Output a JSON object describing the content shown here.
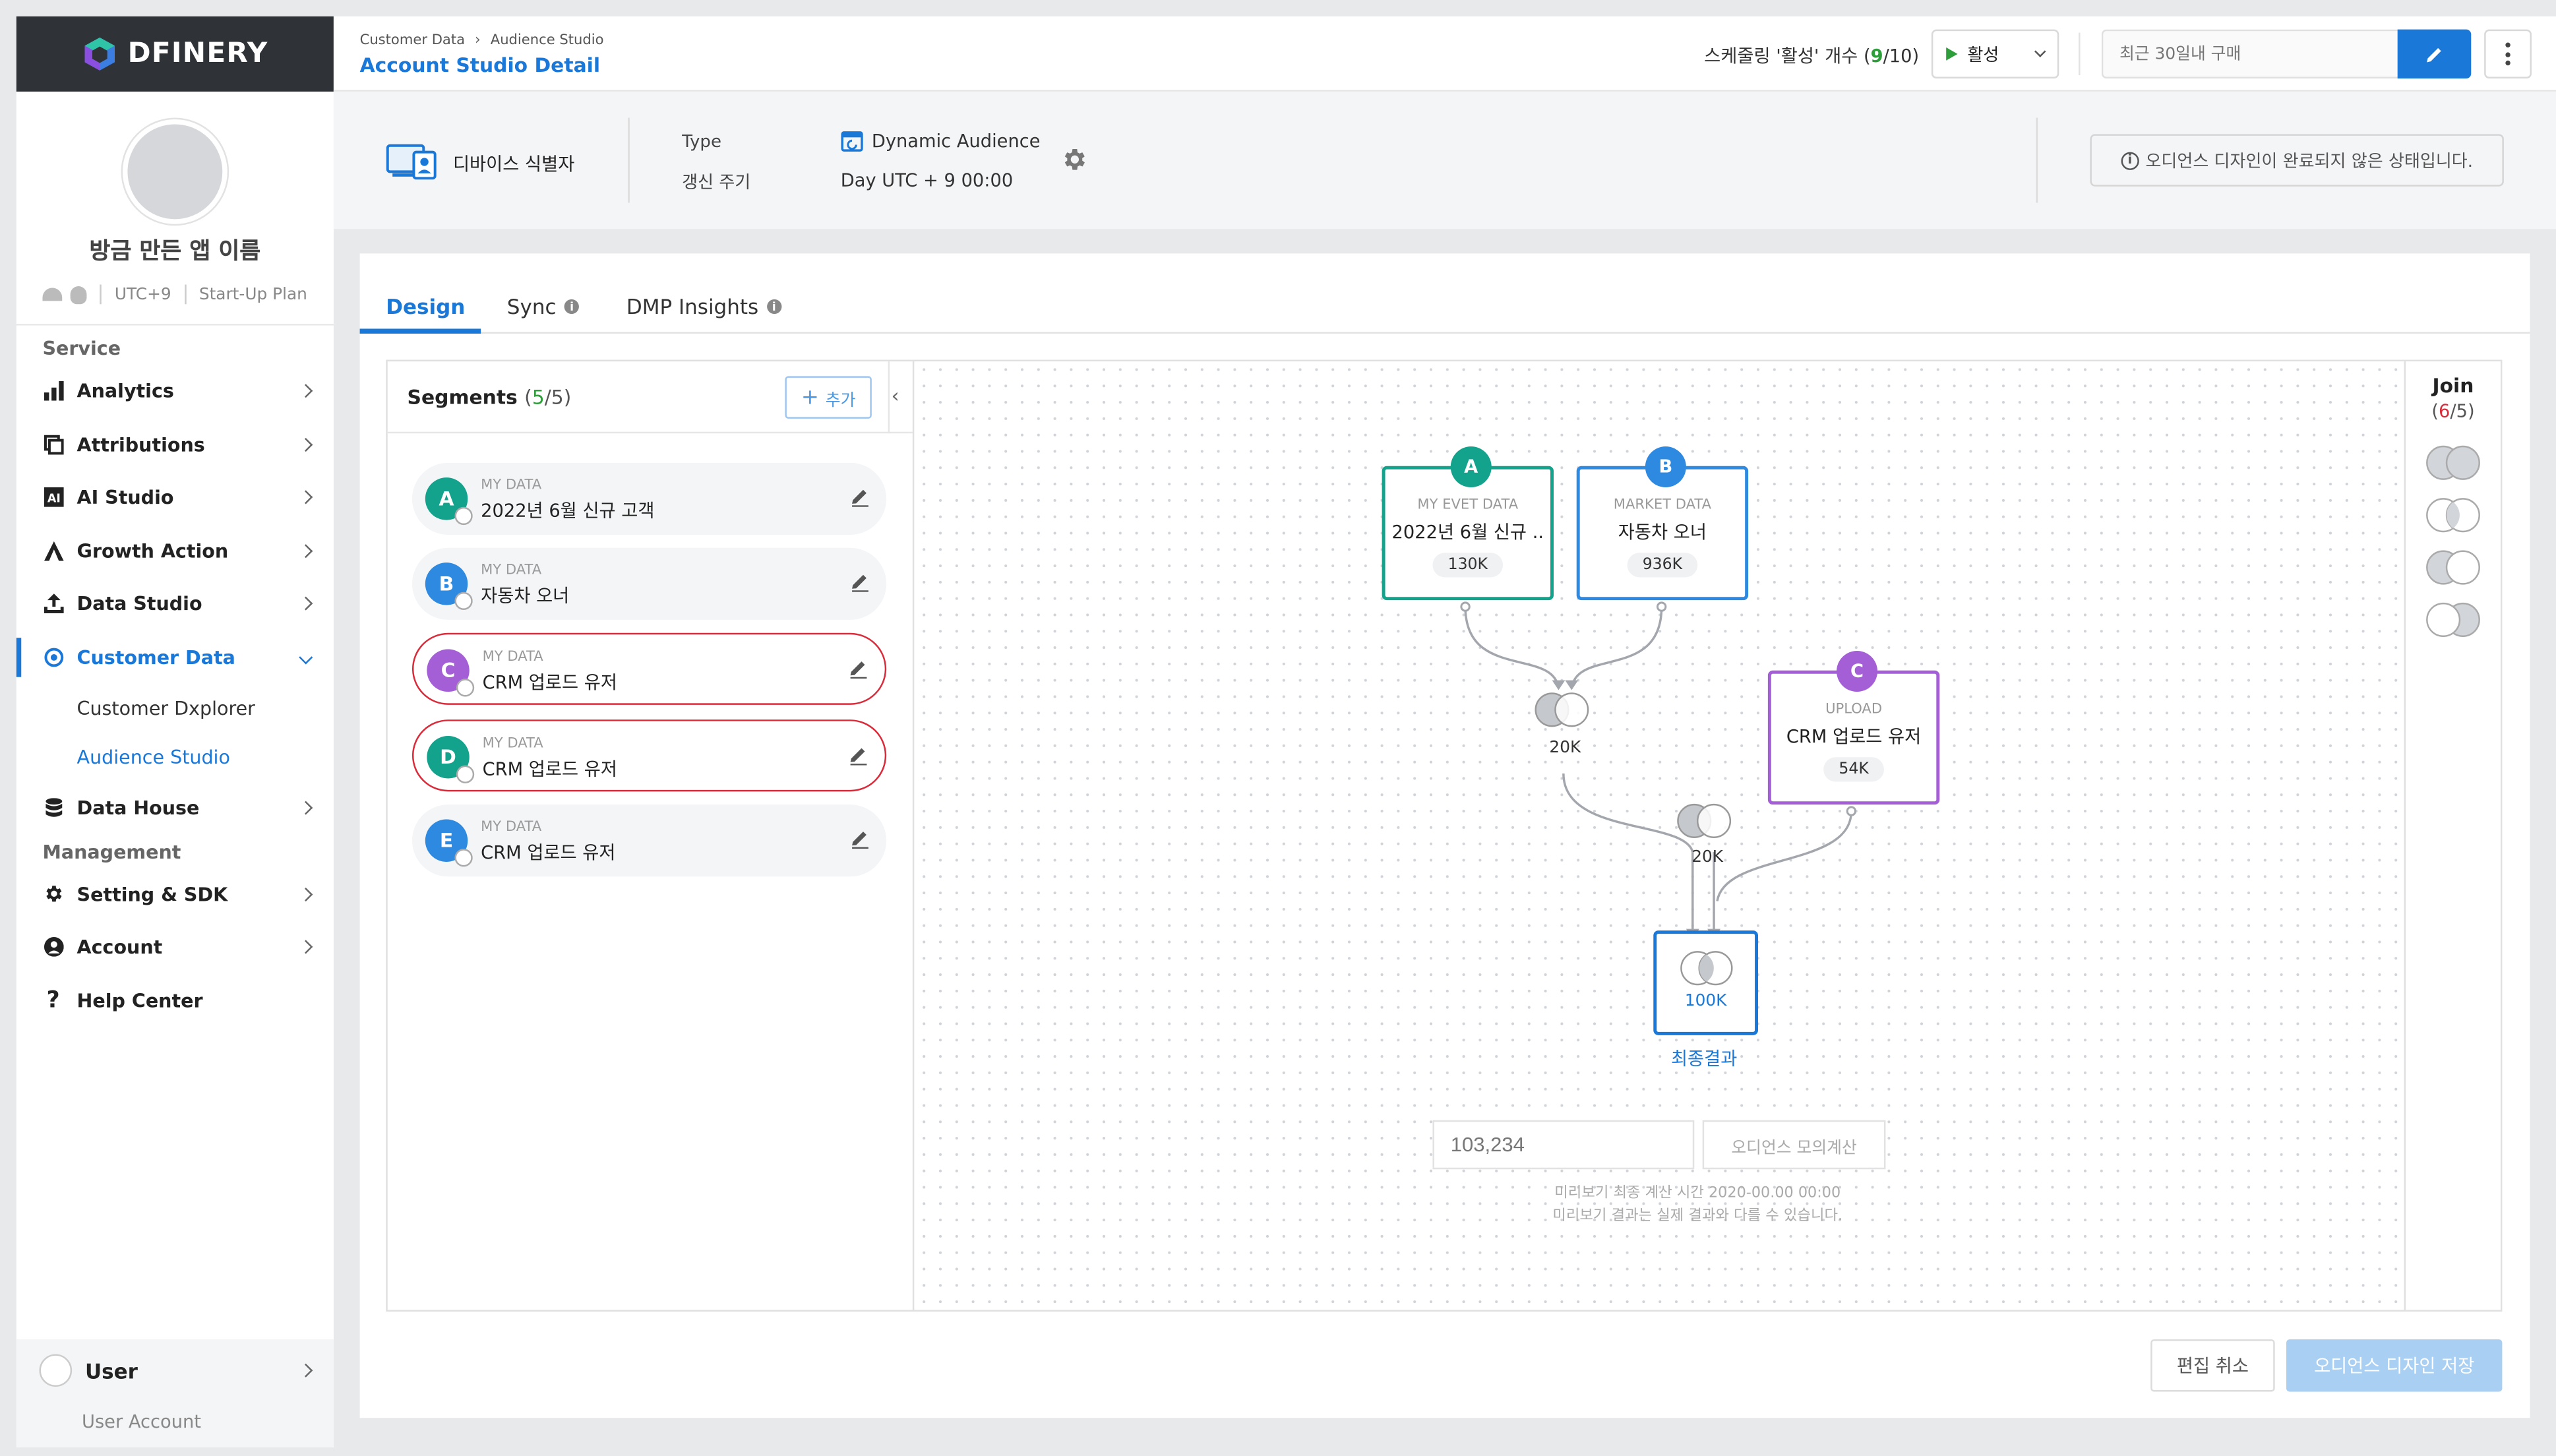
{
  "brand": {
    "name": "DFINERY"
  },
  "profile": {
    "app_name": "방금 만든 앱 이름",
    "timezone": "UTC+9",
    "plan": "Start-Up Plan"
  },
  "sidebar": {
    "service_title": "Service",
    "management_title": "Management",
    "service_items": [
      {
        "label": "Analytics",
        "icon": "bar-chart-icon"
      },
      {
        "label": "Attributions",
        "icon": "attribution-icon"
      },
      {
        "label": "AI Studio",
        "icon": "ai-icon"
      },
      {
        "label": "Growth Action",
        "icon": "growth-icon"
      },
      {
        "label": "Data Studio",
        "icon": "upload-icon"
      },
      {
        "label": "Customer Data",
        "icon": "target-icon"
      }
    ],
    "customer_data_sub": [
      "Customer Dxplorer",
      "Audience Studio"
    ],
    "data_house": {
      "label": "Data House",
      "icon": "database-icon"
    },
    "management_items": [
      {
        "label": "Setting & SDK",
        "icon": "gear-icon"
      },
      {
        "label": "Account",
        "icon": "person-icon"
      },
      {
        "label": "Help Center",
        "icon": "question-icon"
      }
    ],
    "user": {
      "label": "User",
      "sub": "User Account"
    }
  },
  "header": {
    "breadcrumb": [
      "Customer Data",
      "Audience Studio"
    ],
    "title": "Account Studio Detail",
    "schedule_prefix": "스케줄링 '활성' 개수 (",
    "schedule_used": "9",
    "schedule_total": "/10)",
    "status_label": "활성",
    "search_placeholder": "최근 30일내 구매"
  },
  "info": {
    "identifier": "디바이스 식별자",
    "type_label": "Type",
    "cycle_label": "갱신 주기",
    "type_value": "Dynamic Audience",
    "cycle_value": "Day UTC + 9 00:00",
    "notice": "오디언스 디자인이 완료되지 않은 상태입니다."
  },
  "tabs": [
    {
      "label": "Design",
      "active": true
    },
    {
      "label": "Sync",
      "active": false
    },
    {
      "label": "DMP Insights",
      "active": false
    }
  ],
  "segments": {
    "title": "Segments",
    "count": "5",
    "total": "5",
    "add_label": "추가",
    "items": [
      {
        "letter": "A",
        "source": "MY DATA",
        "name": "2022년 6월 신규 고객",
        "color": "#13a38c",
        "selected": false
      },
      {
        "letter": "B",
        "source": "MY DATA",
        "name": "자동차 오너",
        "color": "#2d8ae0",
        "selected": false
      },
      {
        "letter": "C",
        "source": "MY DATA",
        "name": "CRM 업로드 유저",
        "color": "#a45fd6",
        "selected": true
      },
      {
        "letter": "D",
        "source": "MY DATA",
        "name": "CRM 업로드 유저",
        "color": "#13a38c",
        "selected": true
      },
      {
        "letter": "E",
        "source": "MY DATA",
        "name": "CRM 업로드 유저",
        "color": "#2d8ae0",
        "selected": false
      }
    ]
  },
  "flow": {
    "nodes": [
      {
        "letter": "A",
        "source": "MY EVET DATA",
        "name": "2022년 6월 신규 ..",
        "count": "130K",
        "color": "#13a38c"
      },
      {
        "letter": "B",
        "source": "MARKET DATA",
        "name": "자동차 오너",
        "count": "936K",
        "color": "#2d8ae0"
      },
      {
        "letter": "C",
        "source": "UPLOAD",
        "name": "CRM 업로드 유저",
        "count": "54K",
        "color": "#a45fd6"
      }
    ],
    "join1_count": "20K",
    "join2_count": "20K",
    "result_count": "100K",
    "result_label": "최종결과",
    "preview_value": "103,234",
    "preview_button": "오디언스 모의계산",
    "preview_note1": "미리보기 최종 계산 시간 2020-00.00 00:00",
    "preview_note2": "미리보기 결과는 실제 결과와 다를 수 있습니다."
  },
  "join": {
    "title": "Join",
    "count": "6",
    "total": "5)"
  },
  "buttons": {
    "cancel": "편집 취소",
    "save": "오디언스 디자인 저장"
  },
  "colors": {
    "accent": "#1a78d8",
    "green": "#2e9e3a",
    "danger": "#d92b3a"
  }
}
